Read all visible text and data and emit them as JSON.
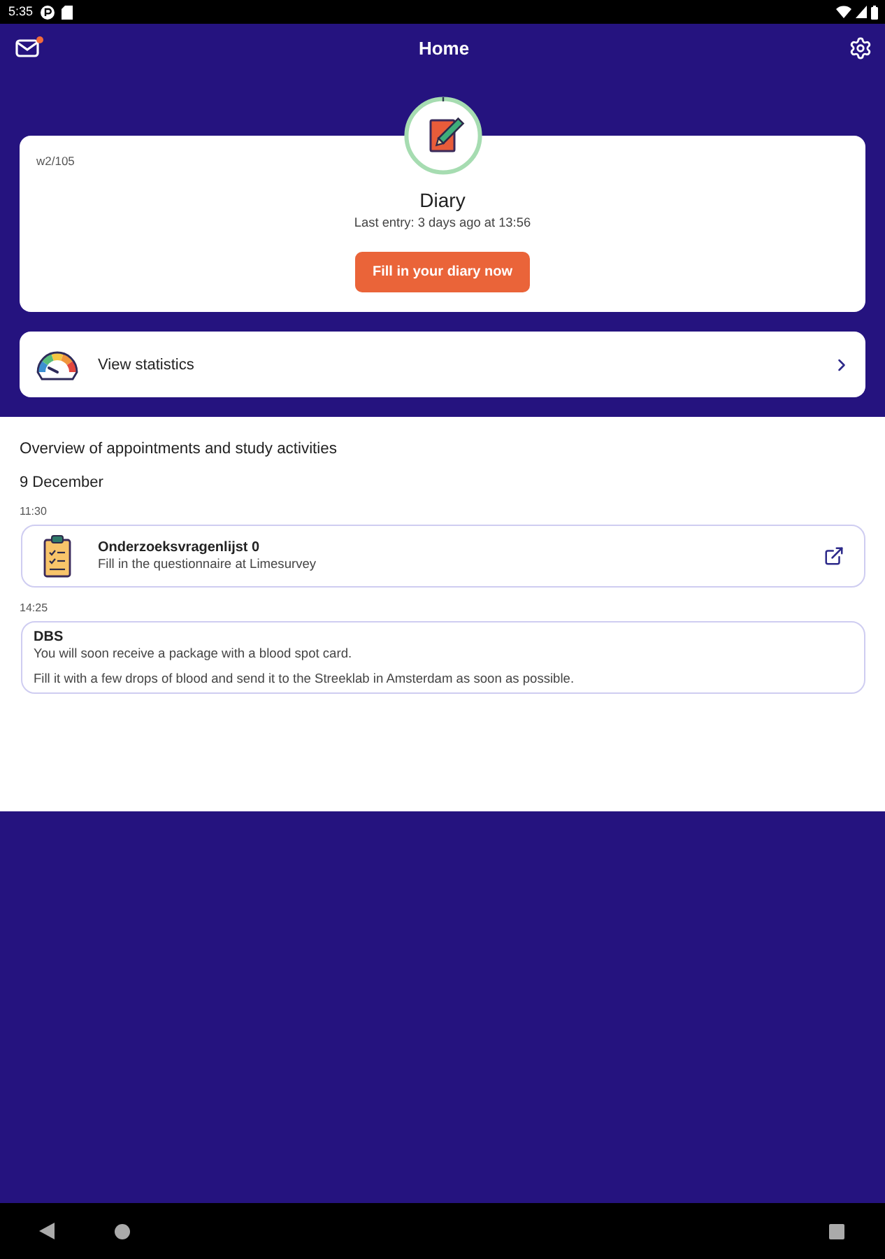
{
  "status_bar": {
    "time": "5:35"
  },
  "app_bar": {
    "title": "Home",
    "unread_mail": true
  },
  "diary_card": {
    "week": "w2/105",
    "title": "Diary",
    "last_entry": "Last entry: 3 days ago at 13:56",
    "button": "Fill in your diary now"
  },
  "statistics": {
    "label": "View statistics"
  },
  "overview": {
    "heading": "Overview of appointments and study activities",
    "days": [
      {
        "date": "9 December",
        "items": [
          {
            "kind": "questionnaire",
            "time": "11:30",
            "title": "Onderzoeksvragenlijst 0",
            "subtitle": "Fill in the questionnaire at Limesurvey"
          },
          {
            "kind": "message",
            "time": "14:25",
            "title": "DBS",
            "paragraphs": [
              "You will soon receive a package with a blood spot card.",
              "Fill it with a few drops of blood and send it to the Streeklab in Amsterdam as soon as possible."
            ]
          }
        ]
      }
    ]
  }
}
